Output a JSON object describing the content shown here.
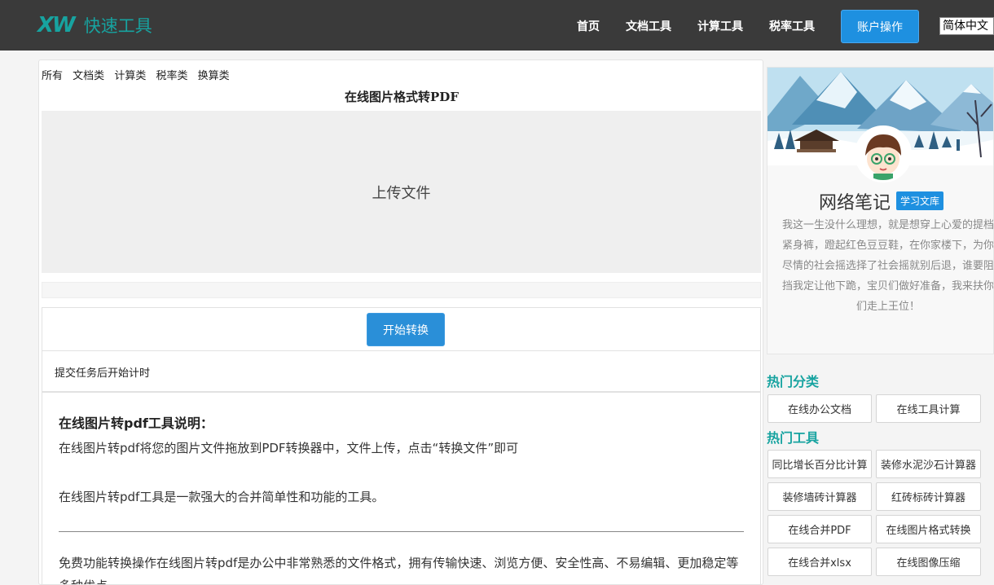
{
  "header": {
    "logo_mark": "XW",
    "logo_text": "快速工具",
    "nav": [
      "首页",
      "文档工具",
      "计算工具",
      "税率工具"
    ],
    "account_button": "账户操作",
    "language": "简体中文"
  },
  "main": {
    "categories": [
      "所有",
      "文档类",
      "计算类",
      "税率类",
      "换算类"
    ],
    "title": "在线图片格式转PDF",
    "upload_label": "上传文件",
    "progress": 0,
    "start_button": "开始转换",
    "timer_text": "提交任务后开始计时",
    "description": {
      "title": "在线图片转pdf工具说明：",
      "p1": "在线图片转pdf将您的图片文件拖放到PDF转换器中，文件上传，点击“转换文件”即可",
      "p2": "在线图片转pdf工具是一款强大的合并简单性和功能的工具。",
      "p3": "免费功能转换操作在线图片转pdf是办公中非常熟悉的文件格式，拥有传输快速、浏览方便、安全性高、不易编辑、更加稳定等多种优点。"
    }
  },
  "sidebar": {
    "profile": {
      "name": "网络笔记",
      "badge": "学习文库",
      "bio": "我这一生没什么理想，就是想穿上心爱的提档紧身裤，蹬起红色豆豆鞋，在你家楼下，为你尽情的社会摇选择了社会摇就别后退，谁要阻挡我定让他下跪，宝贝们做好准备，我来扶你们走上王位！"
    },
    "hot_categories_title": "热门分类",
    "hot_categories": [
      "在线办公文档",
      "在线工具计算"
    ],
    "hot_tools_title": "热门工具",
    "hot_tools": [
      "同比增长百分比计算",
      "装修水泥沙石计算器",
      "装修墙砖计算器",
      "红砖标砖计算器",
      "在线合并PDF",
      "在线图片格式转换",
      "在线合并xlsx",
      "在线图像压缩"
    ]
  },
  "colors": {
    "header_bg": "#3a3a3a",
    "accent": "#17a3a0",
    "primary": "#1e90e0"
  }
}
